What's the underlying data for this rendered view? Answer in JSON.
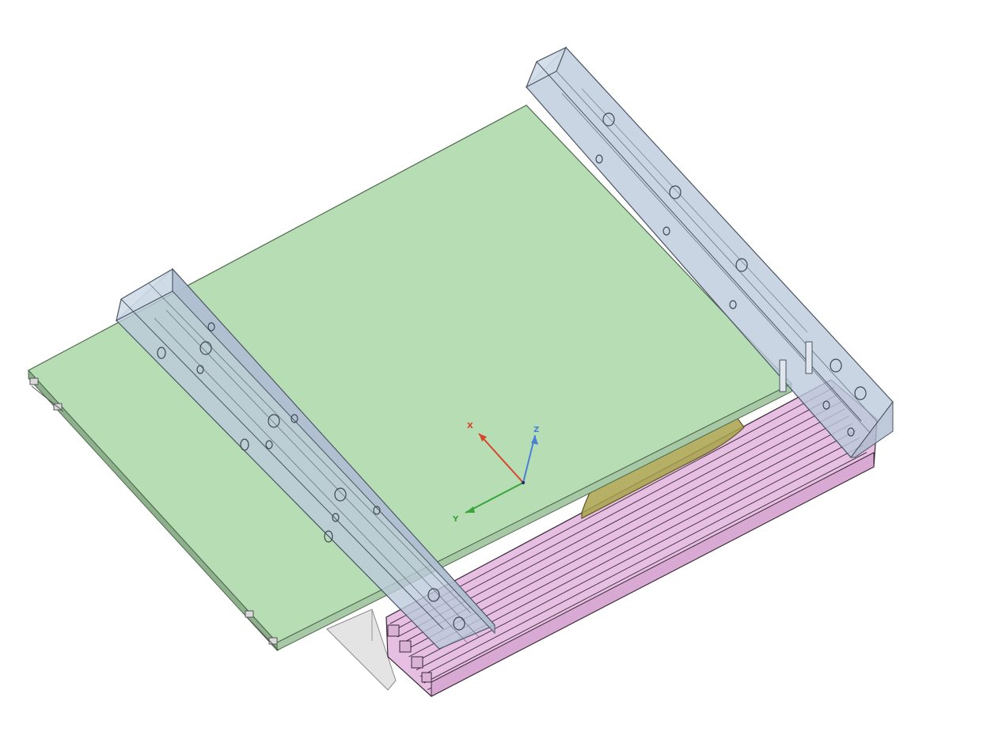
{
  "viewport": {
    "background": "#ffffff",
    "colors": {
      "plate_fill": "#b7ddb5",
      "plate_edge": "#4e6a4d",
      "plate_side": "#8fb08c",
      "rail_fill": "#bccadb",
      "rail_edge": "#4a5563",
      "extrusion_fill": "#e6bfe2",
      "extrusion_line": "#3a2a38",
      "blade_fill": "#a8a24a",
      "blade_edge": "#5a5520",
      "fence_fill": "#e4e4e4",
      "axis_x": "#d9452b",
      "axis_y": "#3aa33a",
      "axis_z": "#4a7fd6"
    },
    "parts": [
      {
        "name": "base-plate",
        "label": ""
      },
      {
        "name": "rail-left",
        "label": ""
      },
      {
        "name": "rail-right",
        "label": ""
      },
      {
        "name": "aluminum-extrusion",
        "label": ""
      },
      {
        "name": "saw-blade",
        "label": ""
      },
      {
        "name": "fence-panel",
        "label": ""
      }
    ]
  },
  "triad": {
    "x_label": "X",
    "y_label": "Y",
    "z_label": "Z"
  }
}
